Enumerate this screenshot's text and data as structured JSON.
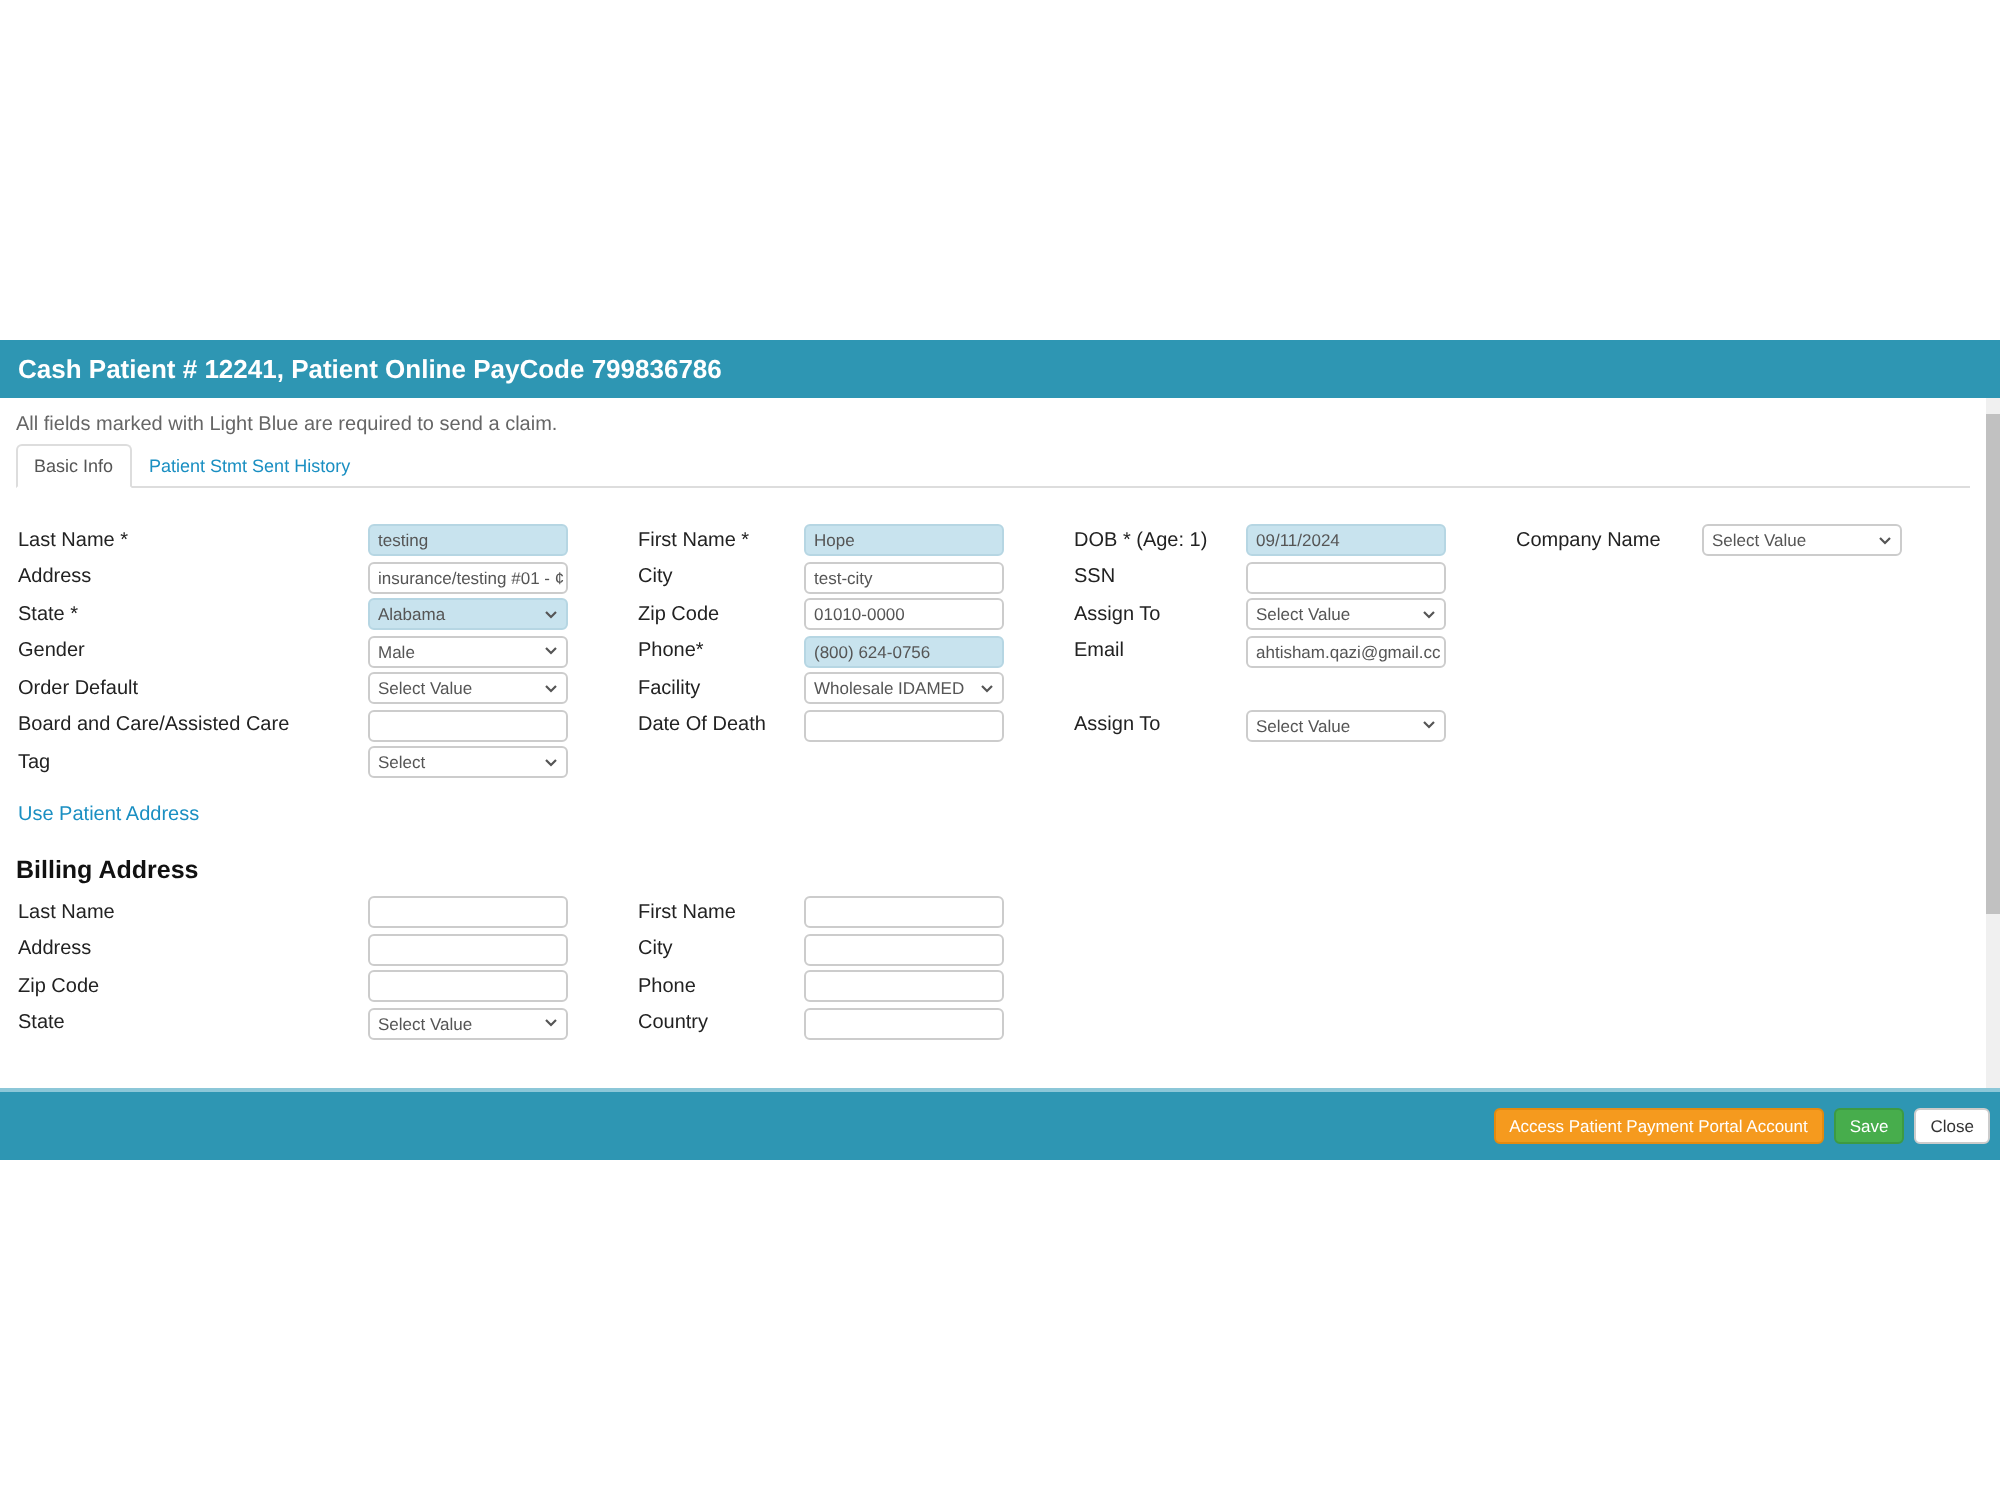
{
  "dialog": {
    "title": "Cash Patient # 12241, Patient Online PayCode 799836786"
  },
  "note": "All fields marked with Light Blue are required to send a claim.",
  "tabs": [
    {
      "label": "Basic Info",
      "selected": true
    },
    {
      "label": "Patient Stmt Sent History",
      "selected": false
    }
  ],
  "patient_fields": [
    [
      {
        "kind": "input",
        "label": "Last Name *",
        "value": "testing",
        "required": true
      },
      {
        "kind": "input",
        "label": "First Name *",
        "value": "Hope",
        "required": true
      },
      {
        "kind": "input",
        "label": "DOB * (Age: 1)",
        "value": "09/11/2024",
        "required": true
      },
      {
        "kind": "select",
        "label": "Company Name",
        "value": "Select Value",
        "required": false
      }
    ],
    [
      {
        "kind": "input",
        "label": "Address",
        "value": "insurance/testing #01 - ¢",
        "required": false
      },
      {
        "kind": "input",
        "label": "City",
        "value": "test-city",
        "required": false
      },
      {
        "kind": "input",
        "label": "SSN",
        "required": false
      }
    ],
    [
      {
        "kind": "select",
        "label": "State *",
        "value": "Alabama",
        "required": true
      },
      {
        "kind": "input",
        "label": "Zip Code",
        "value": "01010-0000",
        "required": false
      },
      {
        "kind": "select",
        "label": "Assign To",
        "value": "Select Value",
        "required": false
      }
    ],
    [
      {
        "kind": "select",
        "label": "Gender",
        "value": "Male",
        "required": false
      },
      {
        "kind": "input",
        "label": "Phone*",
        "value": "(800) 624-0756",
        "required": true
      },
      {
        "kind": "input",
        "label": "Email",
        "value": "ahtisham.qazi@gmail.cc",
        "required": false
      }
    ],
    [
      {
        "kind": "select",
        "label": "Order Default",
        "value": "Select Value",
        "required": false
      },
      {
        "kind": "select",
        "label": "Facility",
        "value": "Wholesale IDAMED",
        "required": false
      }
    ],
    [
      {
        "kind": "input",
        "label": "Board and Care/Assisted Care",
        "required": false
      },
      {
        "kind": "input",
        "label": "Date Of Death",
        "required": false
      },
      {
        "kind": "select",
        "label": "Assign To",
        "value": "Select Value",
        "required": false
      }
    ],
    [
      {
        "kind": "select",
        "label": "Tag",
        "value": "Select",
        "required": false
      }
    ]
  ],
  "use_patient_address_link": "Use Patient Address",
  "billing_heading": "Billing Address",
  "billing_fields": [
    [
      {
        "kind": "input",
        "label": "Last Name",
        "required": false
      },
      {
        "kind": "input",
        "label": "First Name",
        "required": false
      }
    ],
    [
      {
        "kind": "input",
        "label": "Address",
        "required": false
      },
      {
        "kind": "input",
        "label": "City",
        "required": false
      }
    ],
    [
      {
        "kind": "input",
        "label": "Zip Code",
        "required": false
      },
      {
        "kind": "input",
        "label": "Phone",
        "required": false
      }
    ],
    [
      {
        "kind": "select",
        "label": "State",
        "value": "Select Value",
        "required": false
      },
      {
        "kind": "input",
        "label": "Country",
        "required": false
      }
    ]
  ],
  "footer_buttons": [
    {
      "label": "Access Patient Payment Portal Account",
      "kind": "warning"
    },
    {
      "label": "Save",
      "kind": "success"
    },
    {
      "label": "Close",
      "kind": "default"
    }
  ]
}
